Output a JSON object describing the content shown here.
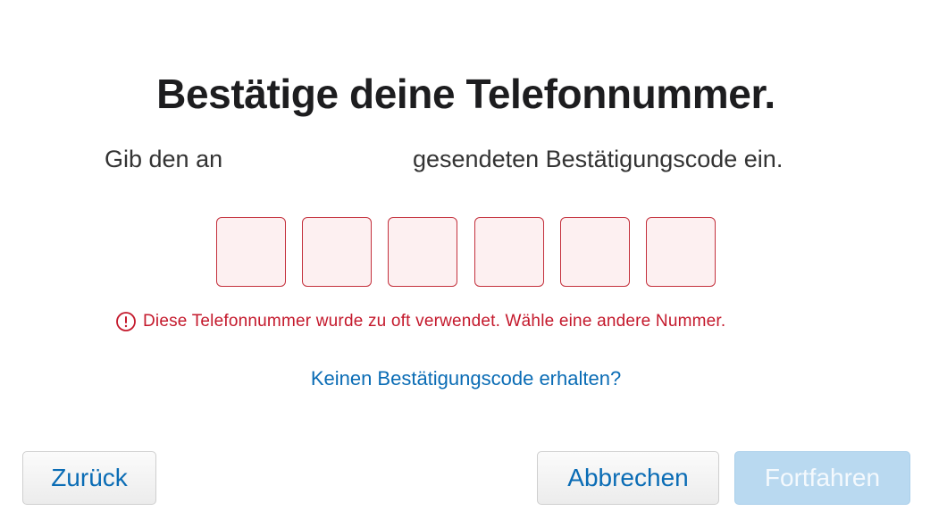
{
  "header": {
    "title": "Bestätige deine Telefonnummer."
  },
  "subtitle": {
    "before": "Gib den an",
    "after": "gesendeten Bestätigungscode ein."
  },
  "code_input": {
    "digits": [
      "",
      "",
      "",
      "",
      "",
      ""
    ]
  },
  "error": {
    "icon": "exclamation-circle-icon",
    "message": "Diese Telefonnummer wurde zu oft verwendet. Wähle eine andere Nummer.",
    "color": "#c4192c"
  },
  "help": {
    "link_label": "Keinen Bestätigungscode erhalten?"
  },
  "footer": {
    "back_label": "Zurück",
    "cancel_label": "Abbrechen",
    "continue_label": "Fortfahren"
  },
  "colors": {
    "link": "#0a6cb5",
    "error": "#c4192c",
    "primary_disabled": "#b9d9f0"
  }
}
